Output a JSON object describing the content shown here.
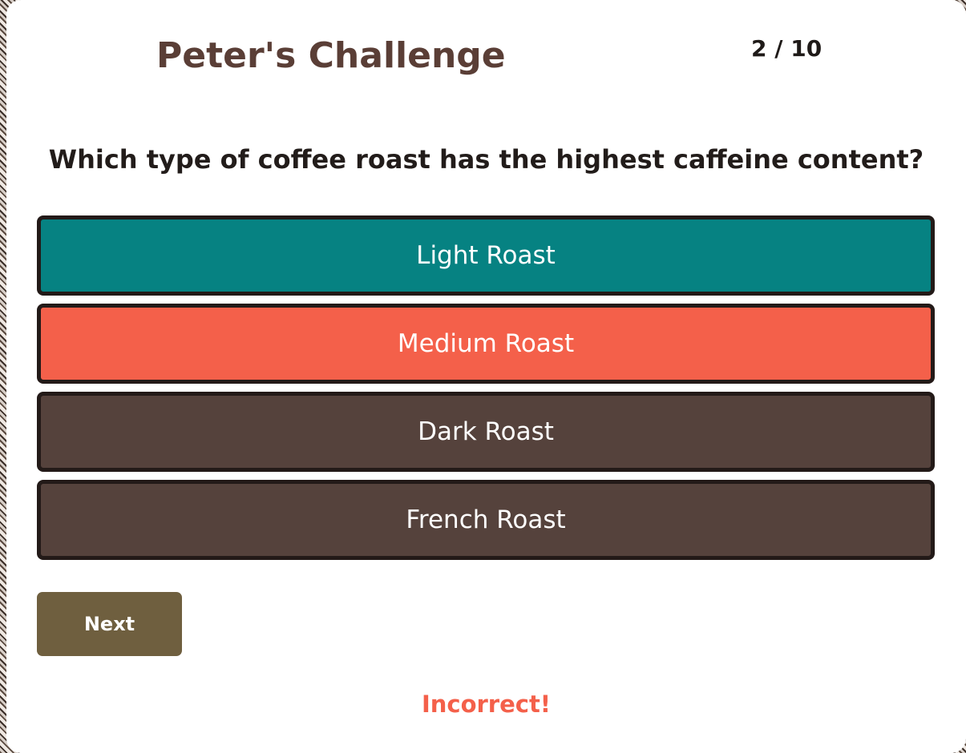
{
  "quiz": {
    "title": "Peter's Challenge",
    "progress": "2 / 10",
    "question": "Which type of coffee roast has the highest caffeine content?",
    "answers": [
      {
        "label": "Light Roast",
        "state": "correct",
        "color": "#068282"
      },
      {
        "label": "Medium Roast",
        "state": "incorrect-selected",
        "color": "#f4604a"
      },
      {
        "label": "Dark Roast",
        "state": "default",
        "color": "#55423c"
      },
      {
        "label": "French Roast",
        "state": "default",
        "color": "#55423c"
      }
    ],
    "next_label": "Next",
    "next_color": "#6f5f3f",
    "feedback": "Incorrect!",
    "feedback_color": "#f4604a"
  }
}
